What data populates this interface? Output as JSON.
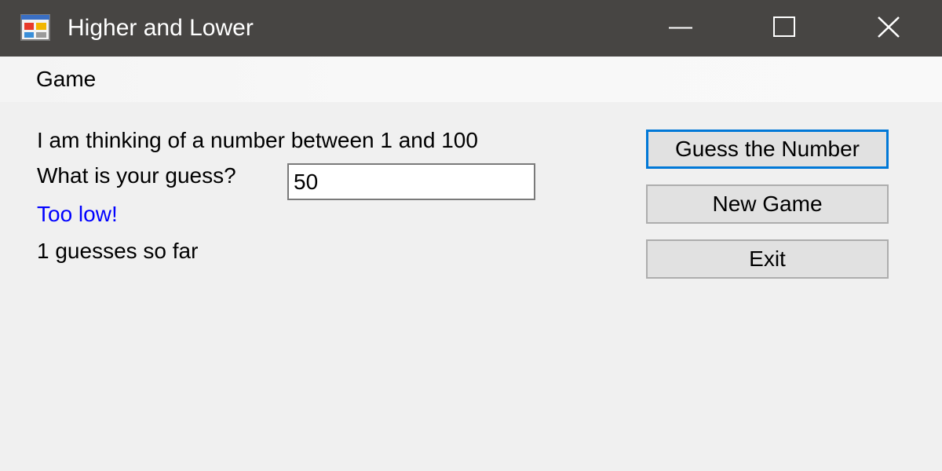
{
  "window": {
    "title": "Higher and Lower",
    "icon": "form-window-icon",
    "controls": [
      "minimize-icon",
      "maximize-icon",
      "close-icon"
    ]
  },
  "menu": {
    "items": [
      {
        "label": "Game"
      }
    ]
  },
  "content": {
    "prompt": "I am thinking of a number between 1 and 100",
    "question": "What is your guess?",
    "guess_value": "50",
    "result": "Too low!",
    "result_color": "#0000ff",
    "guess_count": "1 guesses so far"
  },
  "buttons": {
    "guess": "Guess the Number",
    "new_game": "New Game",
    "exit": "Exit"
  },
  "colors": {
    "titlebar": "#474543",
    "background": "#f0f0f0",
    "accent": "#0078d7"
  }
}
